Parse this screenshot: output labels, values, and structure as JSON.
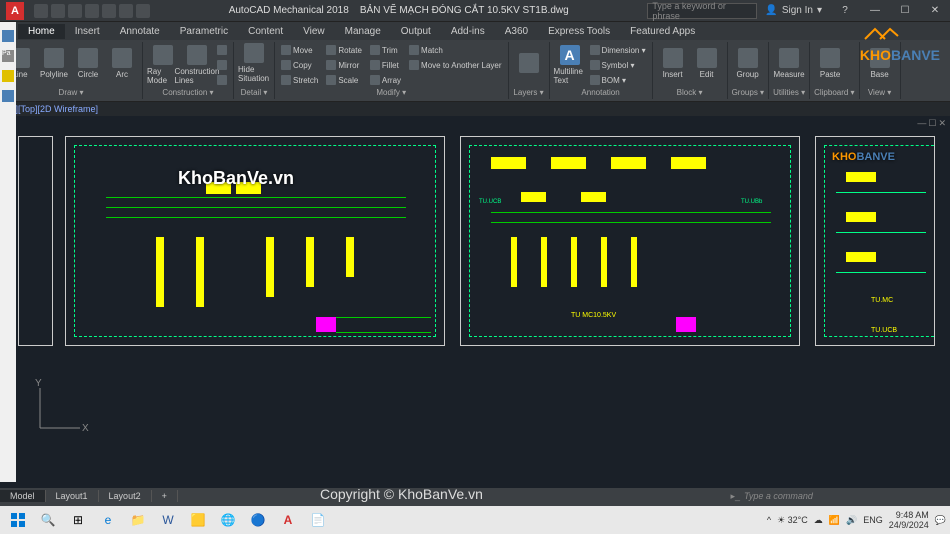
{
  "title": {
    "app": "AutoCAD Mechanical 2018",
    "file": "BẢN VẼ  MẠCH ĐÓNG CẮT 10.5KV ST1B.dwg",
    "search_placeholder": "Type a keyword or phrase",
    "signin": "Sign In"
  },
  "menu": [
    "Home",
    "Insert",
    "Annotate",
    "Parametric",
    "Content",
    "View",
    "Manage",
    "Output",
    "Add-ins",
    "A360",
    "Express Tools",
    "Featured Apps"
  ],
  "ribbon": {
    "draw": {
      "label": "Draw ▾",
      "items": [
        "Line",
        "Polyline",
        "Circle",
        "Arc"
      ]
    },
    "construction": {
      "label": "Construction ▾",
      "items": [
        "Ray Mode",
        "Construction Lines"
      ]
    },
    "detail": {
      "label": "Detail ▾",
      "items": [
        "Hide Situation"
      ]
    },
    "modify": {
      "label": "Modify ▾",
      "rows": [
        [
          "Move",
          "Rotate",
          "Trim"
        ],
        [
          "Copy",
          "Mirror",
          "Fillet"
        ],
        [
          "Stretch",
          "Scale",
          "Array"
        ]
      ],
      "extra": [
        "Match",
        "Move to Another Layer"
      ]
    },
    "layers": {
      "label": "Layers ▾"
    },
    "annotation": {
      "label": "Annotation",
      "items": [
        "Multiline Text",
        "Dimension ▾",
        "Symbol ▾",
        "BOM ▾"
      ]
    },
    "block": {
      "label": "Block ▾",
      "items": [
        "Insert",
        "Edit"
      ]
    },
    "groups": {
      "label": "Groups ▾",
      "items": [
        "Group"
      ]
    },
    "utilities": {
      "label": "Utilities ▾",
      "items": [
        "Measure"
      ]
    },
    "clipboard": {
      "label": "Clipboard ▾",
      "items": [
        "Paste"
      ]
    },
    "view": {
      "label": "View ▾",
      "items": [
        "Base"
      ]
    }
  },
  "doc_tab": "[–][Top][2D Wireframe]",
  "schematic": {
    "labels": [
      "TU.UCB",
      "TU.UBb",
      "TU MC10.5KV",
      "TU.MC",
      "TU.UCB"
    ],
    "watermark1": "KhoBanVe.vn",
    "watermark2": "Copyright © KhoBanVe.vn"
  },
  "cmdline": {
    "placeholder": "Type a command"
  },
  "layout_tabs": [
    "Model",
    "Layout1",
    "Layout2"
  ],
  "statusbar": {
    "model": "MODEL"
  },
  "logo": {
    "kho": "KHO",
    "banve": "BANVE"
  },
  "taskbar": {
    "tray": {
      "temp": "32°C",
      "lang": "ENG",
      "time": "9:48 AM",
      "date": "24/9/2024"
    }
  }
}
